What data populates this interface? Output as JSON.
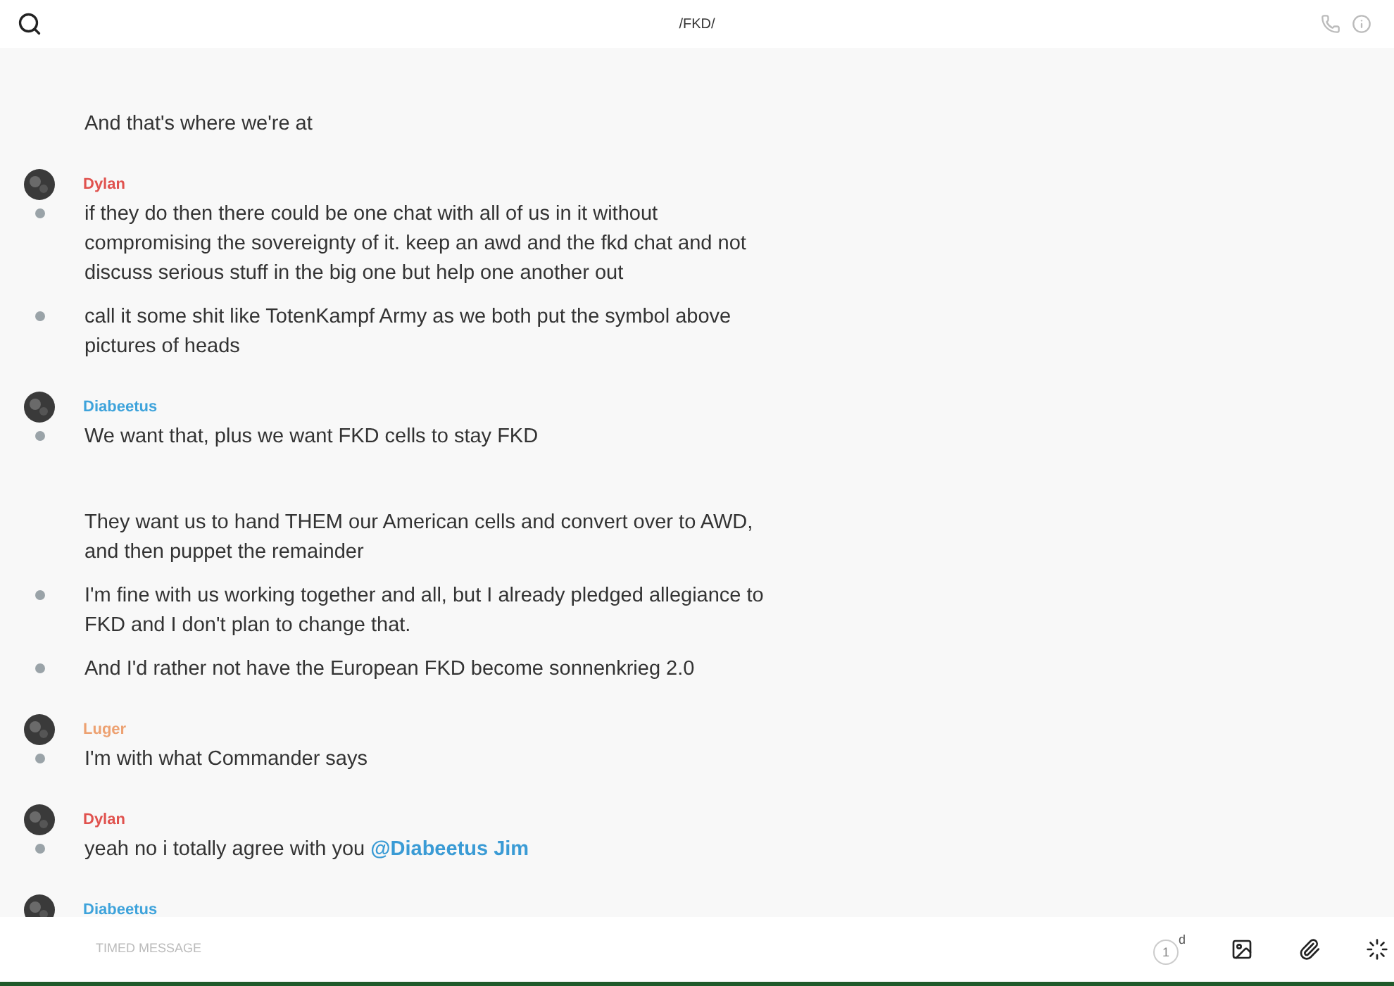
{
  "header": {
    "title": "/FKD/"
  },
  "groups": [
    {
      "messages": [
        {
          "text": "And that's where we're at",
          "marked": false
        }
      ]
    },
    {
      "author": "Dylan",
      "color": "#e0524e",
      "messages": [
        {
          "text": "if they do then there could be one chat with all of us in it without compromising the sovereignty of it. keep an awd and the fkd chat and not discuss serious stuff in the big one but help one another out",
          "marked": true
        },
        {
          "text": "call it some shit like TotenKampf Army as we both put the symbol above pictures of heads",
          "marked": true
        }
      ]
    },
    {
      "author": "Diabeetus",
      "color": "#3ea3db",
      "messages": [
        {
          "text": "We want that, plus we want FKD cells to stay FKD",
          "marked": true
        },
        {
          "text": "They want us to hand THEM our American cells and convert over to AWD, and then puppet the remainder",
          "marked": false
        },
        {
          "text": "I'm fine with us working together and all, but I already pledged allegiance to FKD and I don't plan to change that.",
          "marked": true
        },
        {
          "text": "And I'd rather not have the European FKD become sonnenkrieg 2.0",
          "marked": true
        }
      ]
    },
    {
      "author": "Luger",
      "color": "#eda171",
      "messages": [
        {
          "text": "I'm with what Commander says",
          "marked": true
        }
      ]
    },
    {
      "author": "Dylan",
      "color": "#e0524e",
      "messages": [
        {
          "text": "yeah no i totally agree with you",
          "mention": "@Diabeetus Jim",
          "marked": true
        }
      ]
    },
    {
      "author": "Diabeetus",
      "color": "#3ea3db"
    }
  ],
  "composer": {
    "placeholder": "TIMED MESSAGE",
    "timer": "1",
    "timer_unit": "d"
  }
}
